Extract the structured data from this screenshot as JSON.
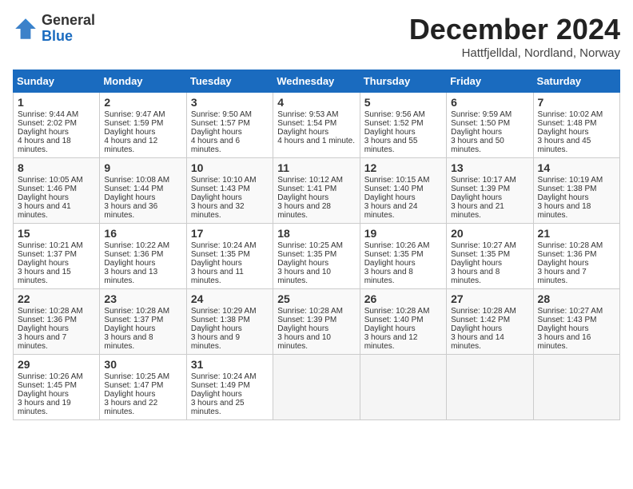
{
  "header": {
    "logo": {
      "general": "General",
      "blue": "Blue"
    },
    "title": "December 2024",
    "location": "Hattfjelldal, Nordland, Norway"
  },
  "days_of_week": [
    "Sunday",
    "Monday",
    "Tuesday",
    "Wednesday",
    "Thursday",
    "Friday",
    "Saturday"
  ],
  "weeks": [
    [
      {
        "day": 1,
        "sunrise": "9:44 AM",
        "sunset": "2:02 PM",
        "daylight": "4 hours and 18 minutes."
      },
      {
        "day": 2,
        "sunrise": "9:47 AM",
        "sunset": "1:59 PM",
        "daylight": "4 hours and 12 minutes."
      },
      {
        "day": 3,
        "sunrise": "9:50 AM",
        "sunset": "1:57 PM",
        "daylight": "4 hours and 6 minutes."
      },
      {
        "day": 4,
        "sunrise": "9:53 AM",
        "sunset": "1:54 PM",
        "daylight": "4 hours and 1 minute."
      },
      {
        "day": 5,
        "sunrise": "9:56 AM",
        "sunset": "1:52 PM",
        "daylight": "3 hours and 55 minutes."
      },
      {
        "day": 6,
        "sunrise": "9:59 AM",
        "sunset": "1:50 PM",
        "daylight": "3 hours and 50 minutes."
      },
      {
        "day": 7,
        "sunrise": "10:02 AM",
        "sunset": "1:48 PM",
        "daylight": "3 hours and 45 minutes."
      }
    ],
    [
      {
        "day": 8,
        "sunrise": "10:05 AM",
        "sunset": "1:46 PM",
        "daylight": "3 hours and 41 minutes."
      },
      {
        "day": 9,
        "sunrise": "10:08 AM",
        "sunset": "1:44 PM",
        "daylight": "3 hours and 36 minutes."
      },
      {
        "day": 10,
        "sunrise": "10:10 AM",
        "sunset": "1:43 PM",
        "daylight": "3 hours and 32 minutes."
      },
      {
        "day": 11,
        "sunrise": "10:12 AM",
        "sunset": "1:41 PM",
        "daylight": "3 hours and 28 minutes."
      },
      {
        "day": 12,
        "sunrise": "10:15 AM",
        "sunset": "1:40 PM",
        "daylight": "3 hours and 24 minutes."
      },
      {
        "day": 13,
        "sunrise": "10:17 AM",
        "sunset": "1:39 PM",
        "daylight": "3 hours and 21 minutes."
      },
      {
        "day": 14,
        "sunrise": "10:19 AM",
        "sunset": "1:38 PM",
        "daylight": "3 hours and 18 minutes."
      }
    ],
    [
      {
        "day": 15,
        "sunrise": "10:21 AM",
        "sunset": "1:37 PM",
        "daylight": "3 hours and 15 minutes."
      },
      {
        "day": 16,
        "sunrise": "10:22 AM",
        "sunset": "1:36 PM",
        "daylight": "3 hours and 13 minutes."
      },
      {
        "day": 17,
        "sunrise": "10:24 AM",
        "sunset": "1:35 PM",
        "daylight": "3 hours and 11 minutes."
      },
      {
        "day": 18,
        "sunrise": "10:25 AM",
        "sunset": "1:35 PM",
        "daylight": "3 hours and 10 minutes."
      },
      {
        "day": 19,
        "sunrise": "10:26 AM",
        "sunset": "1:35 PM",
        "daylight": "3 hours and 8 minutes."
      },
      {
        "day": 20,
        "sunrise": "10:27 AM",
        "sunset": "1:35 PM",
        "daylight": "3 hours and 8 minutes."
      },
      {
        "day": 21,
        "sunrise": "10:28 AM",
        "sunset": "1:36 PM",
        "daylight": "3 hours and 7 minutes."
      }
    ],
    [
      {
        "day": 22,
        "sunrise": "10:28 AM",
        "sunset": "1:36 PM",
        "daylight": "3 hours and 7 minutes."
      },
      {
        "day": 23,
        "sunrise": "10:28 AM",
        "sunset": "1:37 PM",
        "daylight": "3 hours and 8 minutes."
      },
      {
        "day": 24,
        "sunrise": "10:29 AM",
        "sunset": "1:38 PM",
        "daylight": "3 hours and 9 minutes."
      },
      {
        "day": 25,
        "sunrise": "10:28 AM",
        "sunset": "1:39 PM",
        "daylight": "3 hours and 10 minutes."
      },
      {
        "day": 26,
        "sunrise": "10:28 AM",
        "sunset": "1:40 PM",
        "daylight": "3 hours and 12 minutes."
      },
      {
        "day": 27,
        "sunrise": "10:28 AM",
        "sunset": "1:42 PM",
        "daylight": "3 hours and 14 minutes."
      },
      {
        "day": 28,
        "sunrise": "10:27 AM",
        "sunset": "1:43 PM",
        "daylight": "3 hours and 16 minutes."
      }
    ],
    [
      {
        "day": 29,
        "sunrise": "10:26 AM",
        "sunset": "1:45 PM",
        "daylight": "3 hours and 19 minutes."
      },
      {
        "day": 30,
        "sunrise": "10:25 AM",
        "sunset": "1:47 PM",
        "daylight": "3 hours and 22 minutes."
      },
      {
        "day": 31,
        "sunrise": "10:24 AM",
        "sunset": "1:49 PM",
        "daylight": "3 hours and 25 minutes."
      },
      null,
      null,
      null,
      null
    ]
  ]
}
